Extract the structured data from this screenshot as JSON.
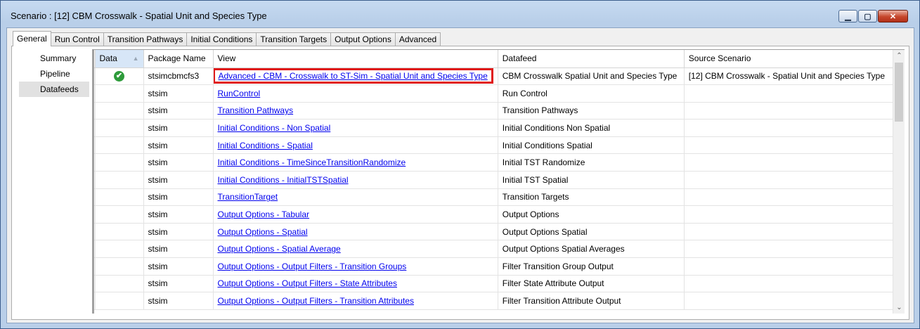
{
  "window": {
    "title": "Scenario : [12] CBM Crosswalk - Spatial Unit and Species Type",
    "minimize": "▁",
    "restore": "▢",
    "close": "✕"
  },
  "tabs": [
    "General",
    "Run Control",
    "Transition Pathways",
    "Initial Conditions",
    "Transition Targets",
    "Output Options",
    "Advanced"
  ],
  "leftnav": [
    "Summary",
    "Pipeline",
    "Datafeeds"
  ],
  "grid": {
    "columns": [
      "Data",
      "Package Name",
      "View",
      "Datafeed",
      "Source Scenario"
    ],
    "rows": [
      {
        "data": "✔",
        "package": "stsimcbmcfs3",
        "view": "Advanced - CBM - Crosswalk to ST-Sim - Spatial Unit and Species Type",
        "datafeed": "CBM Crosswalk Spatial Unit and Species Type",
        "source": "[12] CBM Crosswalk - Spatial Unit and Species Type"
      },
      {
        "data": "",
        "package": "stsim",
        "view": "RunControl",
        "datafeed": "Run Control",
        "source": ""
      },
      {
        "data": "",
        "package": "stsim",
        "view": "Transition Pathways",
        "datafeed": "Transition Pathways",
        "source": ""
      },
      {
        "data": "",
        "package": "stsim",
        "view": "Initial Conditions - Non Spatial",
        "datafeed": "Initial Conditions Non Spatial",
        "source": ""
      },
      {
        "data": "",
        "package": "stsim",
        "view": "Initial Conditions - Spatial",
        "datafeed": "Initial Conditions Spatial",
        "source": ""
      },
      {
        "data": "",
        "package": "stsim",
        "view": "Initial Conditions - TimeSinceTransitionRandomize",
        "datafeed": "Initial TST Randomize",
        "source": ""
      },
      {
        "data": "",
        "package": "stsim",
        "view": "Initial Conditions - InitialTSTSpatial",
        "datafeed": "Initial TST Spatial",
        "source": ""
      },
      {
        "data": "",
        "package": "stsim",
        "view": "TransitionTarget",
        "datafeed": "Transition Targets",
        "source": ""
      },
      {
        "data": "",
        "package": "stsim",
        "view": "Output Options - Tabular",
        "datafeed": "Output Options",
        "source": ""
      },
      {
        "data": "",
        "package": "stsim",
        "view": "Output Options - Spatial",
        "datafeed": "Output Options Spatial",
        "source": ""
      },
      {
        "data": "",
        "package": "stsim",
        "view": "Output Options - Spatial Average",
        "datafeed": "Output Options Spatial Averages",
        "source": ""
      },
      {
        "data": "",
        "package": "stsim",
        "view": "Output Options - Output Filters - Transition Groups",
        "datafeed": "Filter Transition Group Output",
        "source": ""
      },
      {
        "data": "",
        "package": "stsim",
        "view": "Output Options - Output Filters - State Attributes",
        "datafeed": "Filter State Attribute Output",
        "source": ""
      },
      {
        "data": "",
        "package": "stsim",
        "view": "Output Options - Output Filters - Transition Attributes",
        "datafeed": "Filter Transition Attribute Output",
        "source": ""
      }
    ]
  },
  "scroll": {
    "up": "⌃",
    "down": "⌄"
  }
}
